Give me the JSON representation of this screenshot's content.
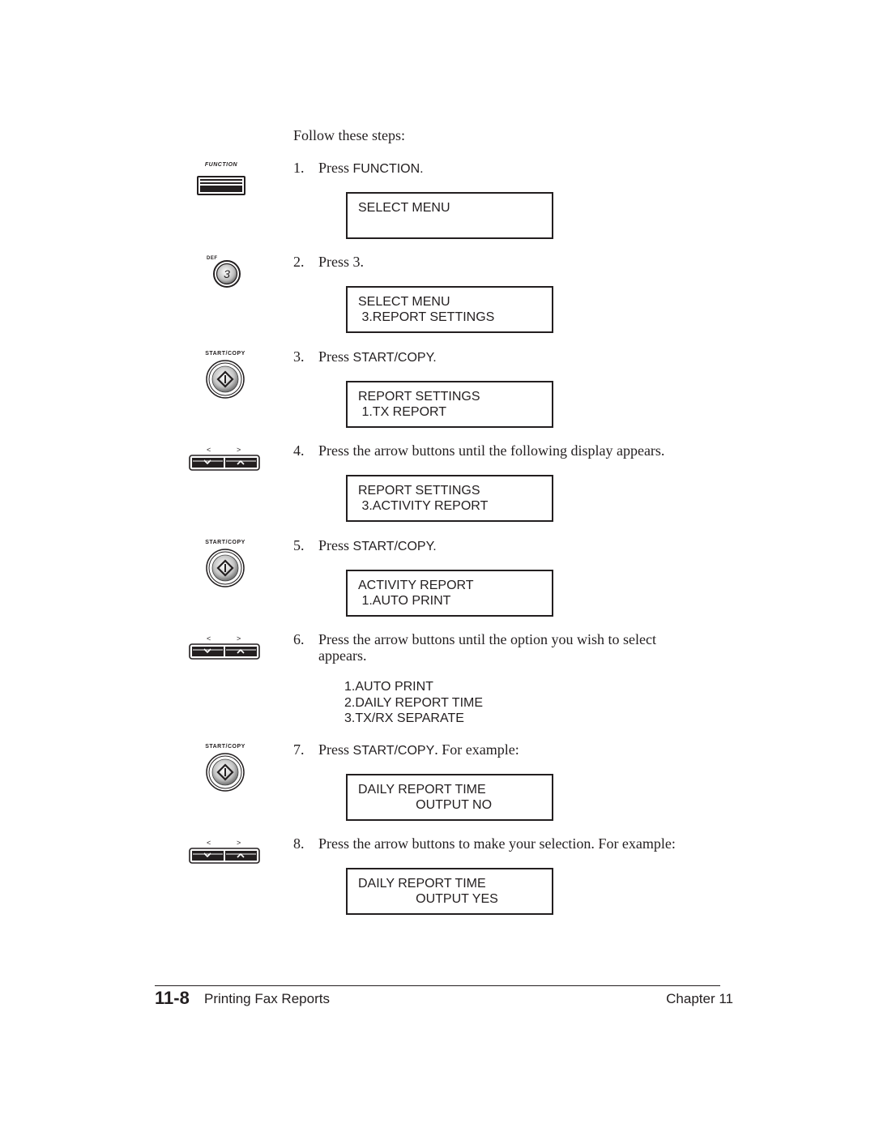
{
  "intro": "Follow these steps:",
  "steps": [
    {
      "num": "1.",
      "text_before": "Press ",
      "key": "FUNCTION",
      "text_after": ".",
      "icon": "function-key-icon",
      "icon_label": "FUNCTION"
    },
    {
      "num": "2.",
      "text_before": "Press ",
      "key": "3",
      "text_after": ".",
      "icon": "number-3-key-icon",
      "icon_label": "DEF",
      "key_glyph": "3"
    },
    {
      "num": "3.",
      "text_before": "Press ",
      "key": "START/COPY",
      "text_after": ".",
      "icon": "start-copy-key-icon",
      "icon_label": "START/COPY"
    },
    {
      "num": "4.",
      "text_before": "Press the arrow buttons until the following display appears.",
      "key": "",
      "text_after": "",
      "icon": "arrow-keys-icon",
      "icon_label_left": "<",
      "icon_label_right": ">"
    },
    {
      "num": "5.",
      "text_before": "Press ",
      "key": "START/COPY",
      "text_after": ".",
      "icon": "start-copy-key-icon",
      "icon_label": "START/COPY"
    },
    {
      "num": "6.",
      "text_before": "Press the arrow buttons until the option you wish to select appears.",
      "key": "",
      "text_after": "",
      "icon": "arrow-keys-icon",
      "icon_label_left": "<",
      "icon_label_right": ">"
    },
    {
      "num": "7.",
      "text_before": "Press ",
      "key": "START/COPY",
      "text_after": ". For example:",
      "icon": "start-copy-key-icon",
      "icon_label": "START/COPY"
    },
    {
      "num": "8.",
      "text_before": "Press the arrow buttons to make your selection. For example:",
      "key": "",
      "text_after": "",
      "icon": "arrow-keys-icon",
      "icon_label_left": "<",
      "icon_label_right": ">"
    }
  ],
  "displays": [
    {
      "line1": "SELECT MENU",
      "line2": ""
    },
    {
      "line1": "SELECT MENU",
      "line2": " 3.REPORT SETTINGS"
    },
    {
      "line1": "REPORT SETTINGS",
      "line2": " 1.TX REPORT"
    },
    {
      "line1": "REPORT SETTINGS",
      "line2": " 3.ACTIVITY REPORT"
    },
    {
      "line1": "ACTIVITY REPORT",
      "line2": " 1.AUTO PRINT"
    },
    {
      "line1": "DAILY REPORT TIME",
      "line2": "                OUTPUT NO"
    },
    {
      "line1": "DAILY REPORT TIME",
      "line2": "                OUTPUT YES"
    }
  ],
  "options": [
    "1.AUTO PRINT",
    "2.DAILY REPORT TIME",
    "3.TX/RX SEPARATE"
  ],
  "footer": {
    "page_number": "11-8",
    "section_title": "Printing Fax Reports",
    "chapter": "Chapter 11"
  }
}
